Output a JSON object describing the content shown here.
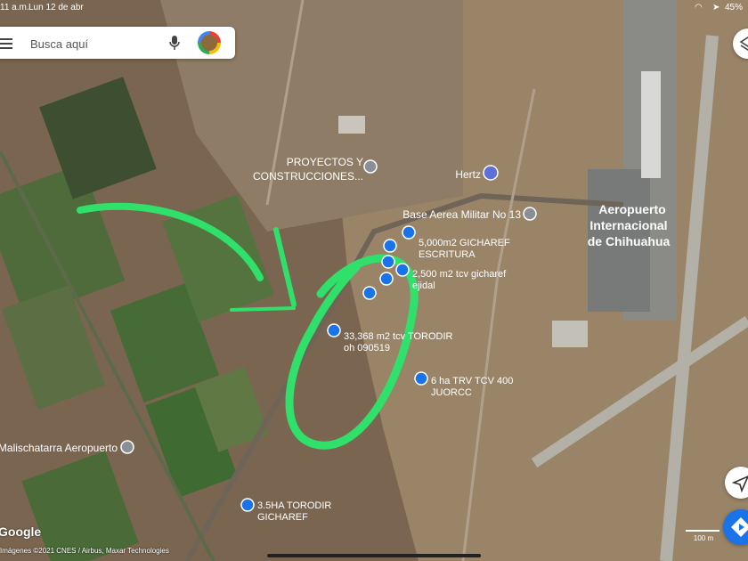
{
  "status_bar": {
    "time": "11 a.m.",
    "date": "Lun 12 de abr",
    "battery": "45%"
  },
  "search": {
    "placeholder": "Busca aquí"
  },
  "places": {
    "proyectos_line1": "PROYECTOS Y",
    "proyectos_line2": "CONSTRUCCIONES...",
    "hertz": "Hertz",
    "base_aerea": "Base Aerea Militar No 13",
    "airport_line1": "Aeropuerto",
    "airport_line2": "Internacional",
    "airport_line3": "de Chihuahua",
    "yonke": "Yonke Malischatarra Aeropuerto"
  },
  "pins": {
    "p1_line1": "5,000m2 GICHAREF",
    "p1_line2": "ESCRITURA",
    "p2_line1": "2,500 m2 tcv gicharef",
    "p2_line2": "ejidal",
    "p3_line1": "33,368 m2 tcv TORODIR",
    "p3_line2": "oh 090519",
    "p4_line1": "6 ha TRV TCV 400",
    "p4_line2": "JUORCC",
    "p5_line1": "3.5HA TORODIR",
    "p5_line2": "GICHAREF"
  },
  "map_ui": {
    "logo": "Google",
    "attribution": "Imágenes ©2021 CNES / Airbus, Maxar Technologies",
    "scale": "100 m"
  },
  "colors": {
    "annotation": "#2fe06a",
    "pin": "#1a73e8",
    "label": "#ffffff"
  }
}
